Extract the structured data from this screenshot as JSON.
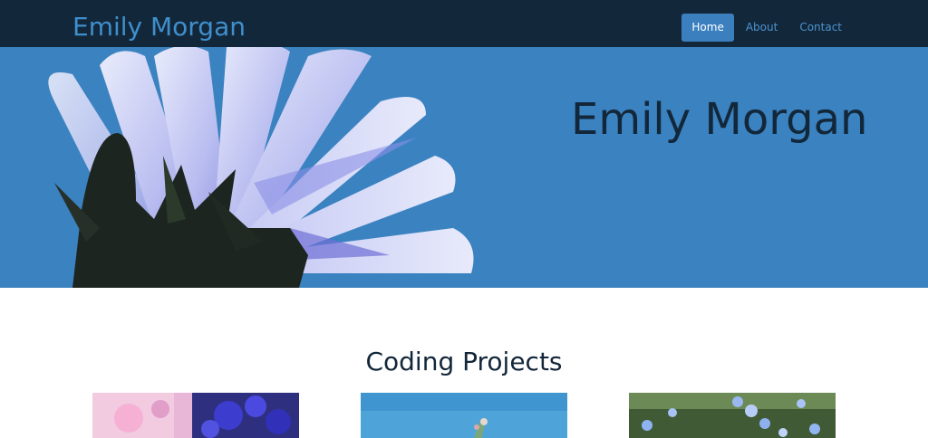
{
  "navbar": {
    "brand": "Emily Morgan",
    "items": [
      {
        "label": "Home",
        "active": true
      },
      {
        "label": "About",
        "active": false
      },
      {
        "label": "Contact",
        "active": false
      }
    ]
  },
  "hero": {
    "title": "Emily Morgan",
    "image": "chicory-flower-photo"
  },
  "projects": {
    "title": "Coding Projects",
    "cards": [
      {
        "image": "pink-blue-flowers-photo"
      },
      {
        "image": "sky-plant-photo"
      },
      {
        "image": "forget-me-not-flowers-photo"
      }
    ]
  },
  "colors": {
    "navbar_bg": "#13273a",
    "brand": "#3f8fcd",
    "active_nav_bg": "#3b7fbf",
    "hero_bg": "#3a82c0",
    "heading": "#13273a"
  }
}
